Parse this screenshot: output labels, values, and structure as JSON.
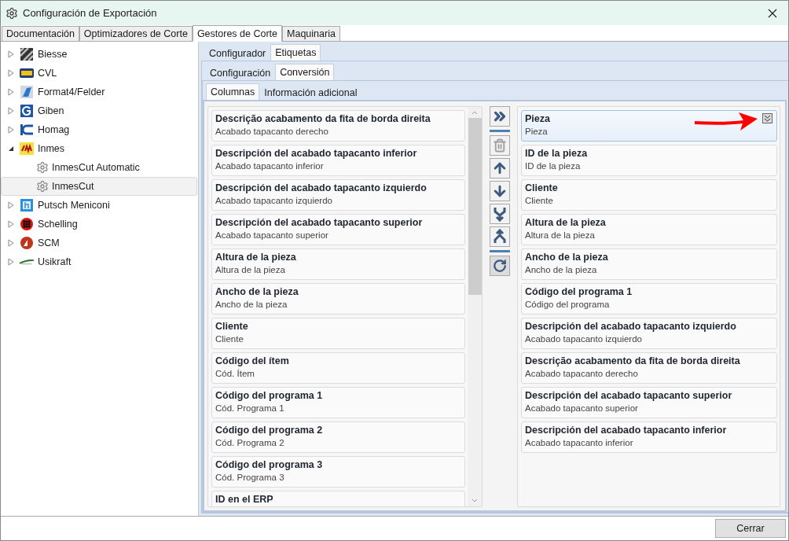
{
  "window": {
    "title": "Configuración de Exportación"
  },
  "main_tabs": [
    {
      "label": "Documentación",
      "selected": false
    },
    {
      "label": "Optimizadores de Corte",
      "selected": false
    },
    {
      "label": "Gestores de Corte",
      "selected": true
    },
    {
      "label": "Maquinaria",
      "selected": false
    }
  ],
  "tree": [
    {
      "label": "Biesse",
      "expanded": false,
      "selected": false
    },
    {
      "label": "CVL",
      "expanded": false,
      "selected": false
    },
    {
      "label": "Format4/Felder",
      "expanded": false,
      "selected": false
    },
    {
      "label": "Giben",
      "expanded": false,
      "selected": false
    },
    {
      "label": "Homag",
      "expanded": false,
      "selected": false
    },
    {
      "label": "Inmes",
      "expanded": true,
      "selected": false,
      "children": [
        {
          "label": "InmesCut Automatic",
          "selected": false
        },
        {
          "label": "InmesCut",
          "selected": true
        }
      ]
    },
    {
      "label": "Putsch Meniconi",
      "expanded": false,
      "selected": false
    },
    {
      "label": "Schelling",
      "expanded": false,
      "selected": false
    },
    {
      "label": "SCM",
      "expanded": false,
      "selected": false
    },
    {
      "label": "Usikraft",
      "expanded": false,
      "selected": false
    }
  ],
  "tabs_level1": [
    {
      "label": "Configurador",
      "selected": false
    },
    {
      "label": "Etiquetas",
      "selected": true
    }
  ],
  "tabs_level2": [
    {
      "label": "Configuración",
      "selected": false
    },
    {
      "label": "Conversión",
      "selected": true
    }
  ],
  "tabs_level3": [
    {
      "label": "Columnas",
      "selected": true
    },
    {
      "label": "Información adicional",
      "selected": false
    }
  ],
  "available_columns": [
    {
      "title": "Descrição acabamento da fita de borda direita",
      "subtitle": "Acabado tapacanto derecho"
    },
    {
      "title": "Descripción del acabado tapacanto inferior",
      "subtitle": "Acabado tapacanto inferior"
    },
    {
      "title": "Descripción del acabado tapacanto izquierdo",
      "subtitle": "Acabado tapacanto izquierdo"
    },
    {
      "title": "Descripción del acabado tapacanto superior",
      "subtitle": "Acabado tapacanto superior"
    },
    {
      "title": "Altura de la pieza",
      "subtitle": "Altura de la pieza"
    },
    {
      "title": "Ancho de la pieza",
      "subtitle": "Ancho de la pieza"
    },
    {
      "title": "Cliente",
      "subtitle": "Cliente"
    },
    {
      "title": "Código del ítem",
      "subtitle": "Cód. Ítem"
    },
    {
      "title": "Código del programa 1",
      "subtitle": "Cód. Programa 1"
    },
    {
      "title": "Código del programa 2",
      "subtitle": "Cód. Programa 2"
    },
    {
      "title": "Código del programa 3",
      "subtitle": "Cód. Programa 3"
    },
    {
      "title": "ID en el ERP"
    }
  ],
  "toolbar": [
    {
      "kind": "add-all",
      "disabled": false
    },
    {
      "kind": "separator"
    },
    {
      "kind": "delete",
      "disabled": true
    },
    {
      "kind": "up",
      "disabled": false
    },
    {
      "kind": "down",
      "disabled": false
    },
    {
      "kind": "merge",
      "disabled": false
    },
    {
      "kind": "split",
      "disabled": false
    },
    {
      "kind": "separator"
    },
    {
      "kind": "reset",
      "disabled": false
    }
  ],
  "selected_columns": [
    {
      "title": "Pieza",
      "subtitle": "Pieza",
      "selected": true
    },
    {
      "title": "ID de la pieza",
      "subtitle": "ID de la pieza",
      "selected": false
    },
    {
      "title": "Cliente",
      "subtitle": "Cliente",
      "selected": false
    },
    {
      "title": "Altura de la pieza",
      "subtitle": "Altura de la pieza",
      "selected": false
    },
    {
      "title": "Ancho de la pieza",
      "subtitle": "Ancho de la pieza",
      "selected": false
    },
    {
      "title": "Código del programa 1",
      "subtitle": "Código del programa",
      "selected": false
    },
    {
      "title": "Descripción del acabado tapacanto izquierdo",
      "subtitle": "Acabado tapacanto izquierdo",
      "selected": false
    },
    {
      "title": "Descrição acabamento da fita de borda direita",
      "subtitle": "Acabado tapacanto derecho",
      "selected": false
    },
    {
      "title": "Descripción del acabado tapacanto superior",
      "subtitle": "Acabado tapacanto superior",
      "selected": false
    },
    {
      "title": "Descripción del acabado tapacanto inferior",
      "subtitle": "Acabado tapacanto inferior",
      "selected": false
    }
  ],
  "buttons": [
    {
      "label": "Cerrar"
    }
  ]
}
